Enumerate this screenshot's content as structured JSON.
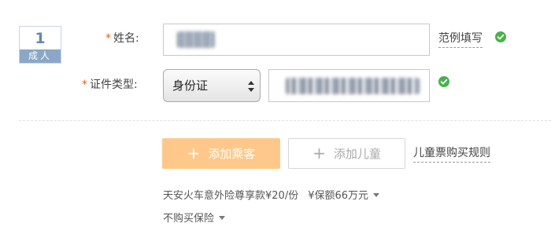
{
  "passenger": {
    "number": "1",
    "type_label": "成人"
  },
  "form": {
    "name_label": "姓名:",
    "id_type_label": "证件类型:",
    "required_mark": "*",
    "id_type_selected": "身份证",
    "example_link": "范例填写",
    "name_status_icon": "check-circle-icon",
    "id_status_icon": "check-circle-icon"
  },
  "actions": {
    "add_passenger_label": "添加乘客",
    "add_child_label": "添加儿童",
    "plus_symbol": "+",
    "child_rules_link": "儿童票购买规则"
  },
  "insurance": {
    "option_selected": "天安火车意外险尊享款¥20/份",
    "coverage_selected": "¥保额66万元",
    "second_option": "不购买保险"
  },
  "colors": {
    "required": "#e25a1a",
    "success_green": "#48b24c",
    "add_passenger_bg": "#fdc889",
    "badge_accent": "#8aa7c6"
  }
}
